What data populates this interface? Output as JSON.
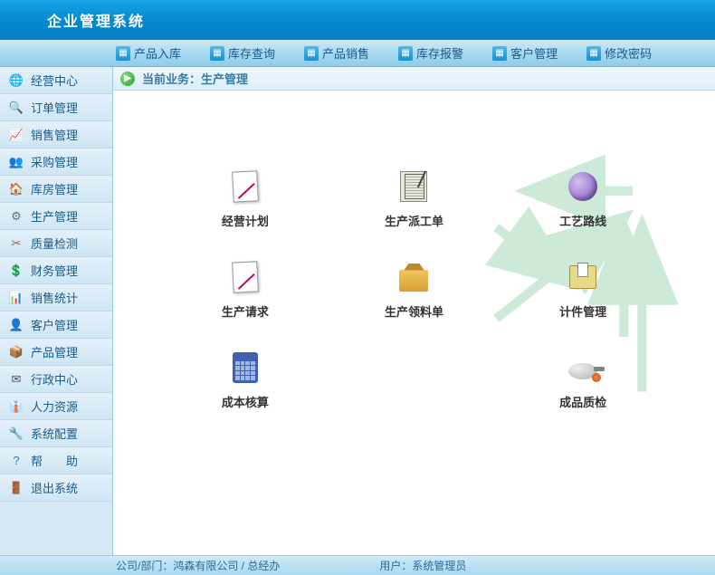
{
  "header": {
    "title": "企业管理系统"
  },
  "toolbar": {
    "items": [
      {
        "label": "产品入库"
      },
      {
        "label": "库存查询"
      },
      {
        "label": "产品销售"
      },
      {
        "label": "库存报警"
      },
      {
        "label": "客户管理"
      },
      {
        "label": "修改密码"
      }
    ]
  },
  "sidebar": {
    "items": [
      {
        "label": "经营中心",
        "icon": "🌐",
        "color": "#2a8fd4"
      },
      {
        "label": "订单管理",
        "icon": "🔍",
        "color": "#b07030"
      },
      {
        "label": "销售管理",
        "icon": "📈",
        "color": "#d04040"
      },
      {
        "label": "采购管理",
        "icon": "👥",
        "color": "#4080d0"
      },
      {
        "label": "库房管理",
        "icon": "🏠",
        "color": "#806040"
      },
      {
        "label": "生产管理",
        "icon": "⚙",
        "color": "#607080"
      },
      {
        "label": "质量检测",
        "icon": "✂",
        "color": "#a06020"
      },
      {
        "label": "财务管理",
        "icon": "💲",
        "color": "#208060"
      },
      {
        "label": "销售统计",
        "icon": "📊",
        "color": "#406090"
      },
      {
        "label": "客户管理",
        "icon": "👤",
        "color": "#c07030"
      },
      {
        "label": "产品管理",
        "icon": "📦",
        "color": "#805030"
      },
      {
        "label": "行政中心",
        "icon": "✉",
        "color": "#505050"
      },
      {
        "label": "人力资源",
        "icon": "👔",
        "color": "#3070b0"
      },
      {
        "label": "系统配置",
        "icon": "🔧",
        "color": "#806030"
      },
      {
        "label": "帮　　助",
        "icon": "?",
        "color": "#3080c0"
      },
      {
        "label": "退出系统",
        "icon": "🚪",
        "color": "#202020"
      }
    ]
  },
  "breadcrumb": {
    "prefix": "当前业务：",
    "current": "生产管理"
  },
  "modules": [
    {
      "label": "经营计划",
      "icon": "notepad"
    },
    {
      "label": "生产派工单",
      "icon": "form"
    },
    {
      "label": "工艺路线",
      "icon": "eclipse"
    },
    {
      "label": "生产请求",
      "icon": "notepad"
    },
    {
      "label": "生产领料单",
      "icon": "box"
    },
    {
      "label": "计件管理",
      "icon": "folder"
    },
    {
      "label": "成本核算",
      "icon": "calc"
    },
    {
      "label": "",
      "icon": ""
    },
    {
      "label": "成品质检",
      "icon": "pan"
    }
  ],
  "statusbar": {
    "company_label": "公司/部门：",
    "company_value": "鸿森有限公司 / 总经办",
    "user_label": "用户：",
    "user_value": "系统管理员"
  }
}
